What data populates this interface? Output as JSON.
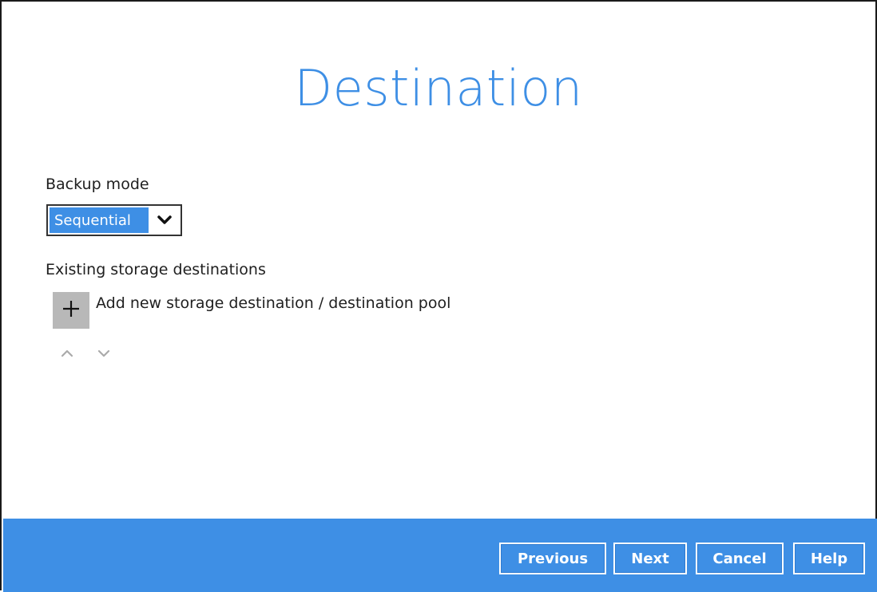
{
  "page": {
    "title": "Destination"
  },
  "backup_mode": {
    "label": "Backup mode",
    "selected": "Sequential",
    "icon": "chevron-down-icon"
  },
  "storage": {
    "label": "Existing storage destinations",
    "add_label": "Add new storage destination / destination pool",
    "add_icon": "plus-icon",
    "move_up_icon": "chevron-up-icon",
    "move_down_icon": "chevron-down-icon"
  },
  "footer": {
    "previous": "Previous",
    "next": "Next",
    "cancel": "Cancel",
    "help": "Help"
  },
  "colors": {
    "accent": "#3e8fe5",
    "add_button_bg": "#b8b8b8",
    "text": "#202020"
  }
}
